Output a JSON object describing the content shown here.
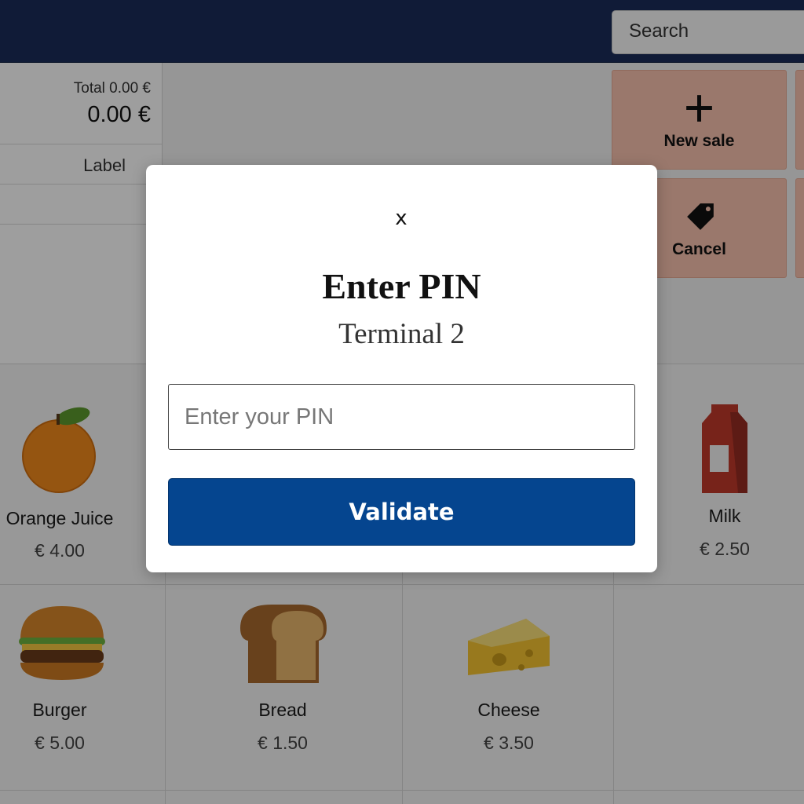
{
  "header": {
    "search_label": "Search"
  },
  "order": {
    "total_label": "Total  0.00 €",
    "total_amount": "0.00 €",
    "column_label": "Label"
  },
  "actions": [
    {
      "label": "New sale",
      "icon": "plus-icon"
    },
    {
      "label": "Cancel",
      "icon": "tag-icon"
    }
  ],
  "products": [
    {
      "name": "Orange Juice",
      "price": "€ 4.00",
      "icon": "orange-icon"
    },
    {
      "name": "Milk",
      "price": "€ 2.50",
      "icon": "milk-carton-icon"
    },
    {
      "name": "Burger",
      "price": "€ 5.00",
      "icon": "burger-icon"
    },
    {
      "name": "Bread",
      "price": "€ 1.50",
      "icon": "bread-icon"
    },
    {
      "name": "Cheese",
      "price": "€ 3.50",
      "icon": "cheese-icon"
    }
  ],
  "modal": {
    "close_label": "x",
    "title": "Enter PIN",
    "subtitle": "Terminal 2",
    "pin_placeholder": "Enter your PIN",
    "pin_value": "",
    "validate_label": "Validate"
  },
  "colors": {
    "header_bg": "#1a2d5a",
    "action_bg": "#f8c2ae",
    "validate_bg": "#05458f"
  }
}
